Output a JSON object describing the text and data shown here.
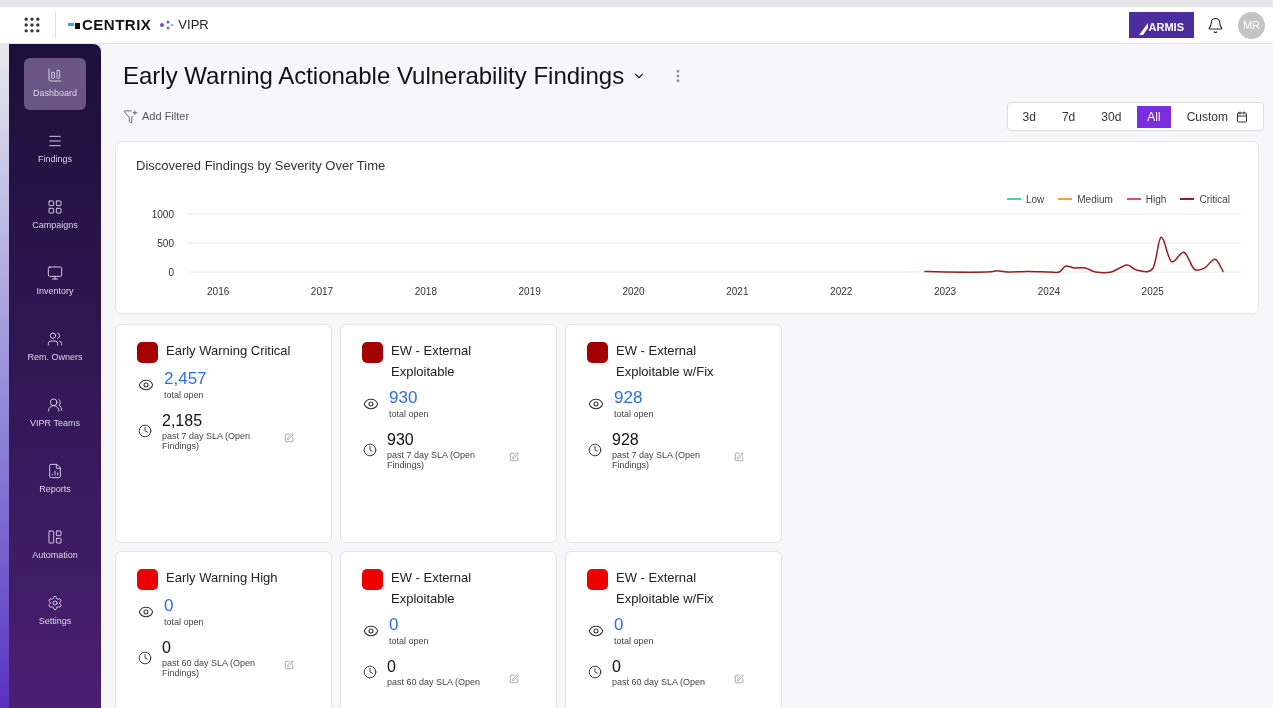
{
  "topbar": {
    "brand": "CENTRIX",
    "product": "VIPR",
    "partner": "ARMIS",
    "avatar": "MR"
  },
  "sidebar": {
    "items": [
      {
        "label": "Dashboard",
        "selected": true
      },
      {
        "label": "Findings",
        "selected": false
      },
      {
        "label": "Campaigns",
        "selected": false
      },
      {
        "label": "Inventory",
        "selected": false
      },
      {
        "label": "Rem. Owners",
        "selected": false
      },
      {
        "label": "VIPR Teams",
        "selected": false
      },
      {
        "label": "Reports",
        "selected": false
      },
      {
        "label": "Automation",
        "selected": false
      },
      {
        "label": "Settings",
        "selected": false
      }
    ]
  },
  "page": {
    "title": "Early Warning Actionable Vulnerability Findings",
    "add_filter": "Add Filter"
  },
  "time_range": [
    {
      "label": "3d",
      "selected": false
    },
    {
      "label": "7d",
      "selected": false
    },
    {
      "label": "30d",
      "selected": false
    },
    {
      "label": "All",
      "selected": true
    },
    {
      "label": "Custom",
      "selected": false
    }
  ],
  "chart": {
    "chart_data": {
      "type": "line",
      "title": "Discovered Findings by Severity Over Time",
      "x": [
        2022.8,
        2023.0,
        2023.4,
        2023.5,
        2023.6,
        2023.8,
        2024.0,
        2024.1,
        2024.16,
        2024.25,
        2024.35,
        2024.45,
        2024.6,
        2024.75,
        2024.85,
        2025.0,
        2025.08,
        2025.18,
        2025.3,
        2025.4,
        2025.5,
        2025.6,
        2025.68
      ],
      "series": [
        {
          "name": "Low",
          "color": "#4fd1a5",
          "values": [
            null,
            null,
            null,
            null,
            null,
            null,
            null,
            null,
            null,
            null,
            null,
            null,
            null,
            null,
            null,
            null,
            null,
            null,
            null,
            null,
            null,
            null,
            null
          ]
        },
        {
          "name": "Medium",
          "color": "#f0a04b",
          "values": [
            null,
            null,
            null,
            null,
            null,
            null,
            null,
            null,
            null,
            null,
            null,
            null,
            null,
            null,
            null,
            null,
            null,
            null,
            null,
            null,
            null,
            null,
            null
          ]
        },
        {
          "name": "High",
          "color": "#e05252",
          "values": [
            null,
            null,
            null,
            null,
            null,
            null,
            null,
            null,
            null,
            null,
            null,
            null,
            null,
            null,
            null,
            null,
            null,
            null,
            null,
            null,
            null,
            null,
            null
          ]
        },
        {
          "name": "Critical",
          "color": "#9b1c1c",
          "values": [
            10,
            0,
            0,
            20,
            0,
            10,
            0,
            0,
            100,
            70,
            70,
            0,
            0,
            120,
            30,
            60,
            600,
            180,
            340,
            50,
            70,
            220,
            0
          ]
        }
      ],
      "xlim": [
        2015.7,
        2025.85
      ],
      "ylim": [
        0,
        1000
      ],
      "xticks": [
        2016,
        2017,
        2018,
        2019,
        2020,
        2021,
        2022,
        2023,
        2024,
        2025
      ],
      "yticks": [
        0,
        500,
        1000
      ]
    }
  },
  "cards": [
    {
      "title": "Early Warning Critical",
      "color": "#a30000",
      "total": "2,457",
      "total_label": "total open",
      "sla_value": "2,185",
      "sla_label": "past 7 day SLA (Open Findings)"
    },
    {
      "title": "EW - External Exploitable",
      "color": "#a30000",
      "total": "930",
      "total_label": "total open",
      "sla_value": "930",
      "sla_label": "past 7 day SLA (Open Findings)"
    },
    {
      "title": "EW - External Exploitable w/Fix",
      "color": "#a30000",
      "total": "928",
      "total_label": "total open",
      "sla_value": "928",
      "sla_label": "past 7 day SLA (Open Findings)"
    },
    {
      "title": "Early Warning High",
      "color": "#ee0000",
      "total": "0",
      "total_label": "total open",
      "sla_value": "0",
      "sla_label": "past 60 day SLA (Open Findings)"
    },
    {
      "title": "EW - External Exploitable",
      "color": "#ee0000",
      "total": "0",
      "total_label": "total open",
      "sla_value": "0",
      "sla_label": "past 60 day SLA (Open"
    },
    {
      "title": "EW - External Exploitable w/Fix",
      "color": "#ee0000",
      "total": "0",
      "total_label": "total open",
      "sla_value": "0",
      "sla_label": "past 60 day SLA (Open"
    }
  ]
}
